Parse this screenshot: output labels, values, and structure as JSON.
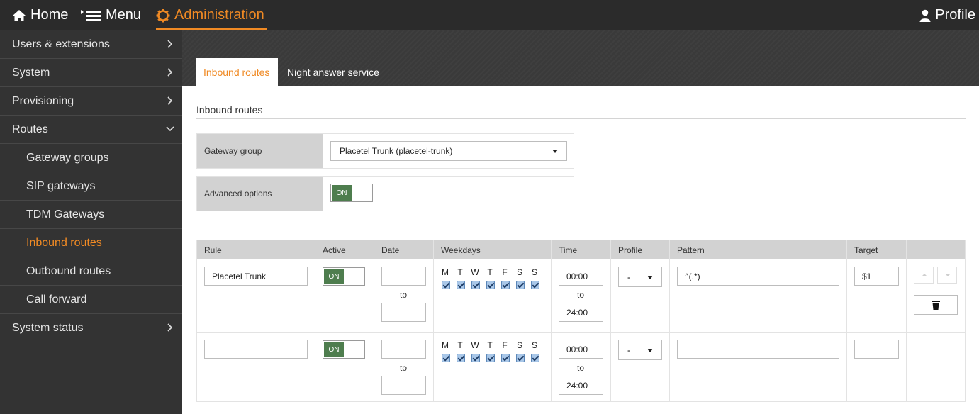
{
  "topbar": {
    "home_label": "Home",
    "menu_label": "Menu",
    "admin_label": "Administration",
    "profile_label": "Profile",
    "accent_color": "#f08a24"
  },
  "sidebar": {
    "items": [
      {
        "label": "Users & extensions",
        "chevron": "right"
      },
      {
        "label": "System",
        "chevron": "right"
      },
      {
        "label": "Provisioning",
        "chevron": "right"
      },
      {
        "label": "Routes",
        "chevron": "down"
      },
      {
        "label": "Gateway groups"
      },
      {
        "label": "SIP gateways"
      },
      {
        "label": "TDM Gateways"
      },
      {
        "label": "Inbound routes",
        "active": true
      },
      {
        "label": "Outbound routes"
      },
      {
        "label": "Call forward"
      },
      {
        "label": "System status",
        "chevron": "right"
      }
    ]
  },
  "tabs": [
    {
      "label": "Inbound routes",
      "active": true
    },
    {
      "label": "Night answer service",
      "active": false
    }
  ],
  "section": {
    "title": "Inbound routes"
  },
  "form": {
    "gateway_group_label": "Gateway group",
    "gateway_group_value": "Placetel Trunk (placetel-trunk)",
    "advanced_options_label": "Advanced options",
    "advanced_options_toggle": "ON"
  },
  "table": {
    "headers": [
      "Rule",
      "Active",
      "Date",
      "Weekdays",
      "Time",
      "Profile",
      "Pattern",
      "Target"
    ],
    "weekday_letters": [
      "M",
      "T",
      "W",
      "T",
      "F",
      "S",
      "S"
    ],
    "rows": [
      {
        "rule": "Placetel Trunk",
        "active": "ON",
        "date_to_label": "to",
        "weekdays_checked": [
          true,
          true,
          true,
          true,
          true,
          true,
          true
        ],
        "time_from": "00:00",
        "time_to_label": "to",
        "time_to": "24:00",
        "profile": "-",
        "pattern": "^(.*)",
        "target": "$1"
      },
      {
        "rule": "",
        "active": "ON",
        "date_to_label": "to",
        "weekdays_checked": [
          true,
          true,
          true,
          true,
          true,
          true,
          true
        ],
        "time_from": "00:00",
        "time_to_label": "to",
        "time_to": "24:00",
        "profile": "-",
        "pattern": "",
        "target": ""
      }
    ]
  }
}
